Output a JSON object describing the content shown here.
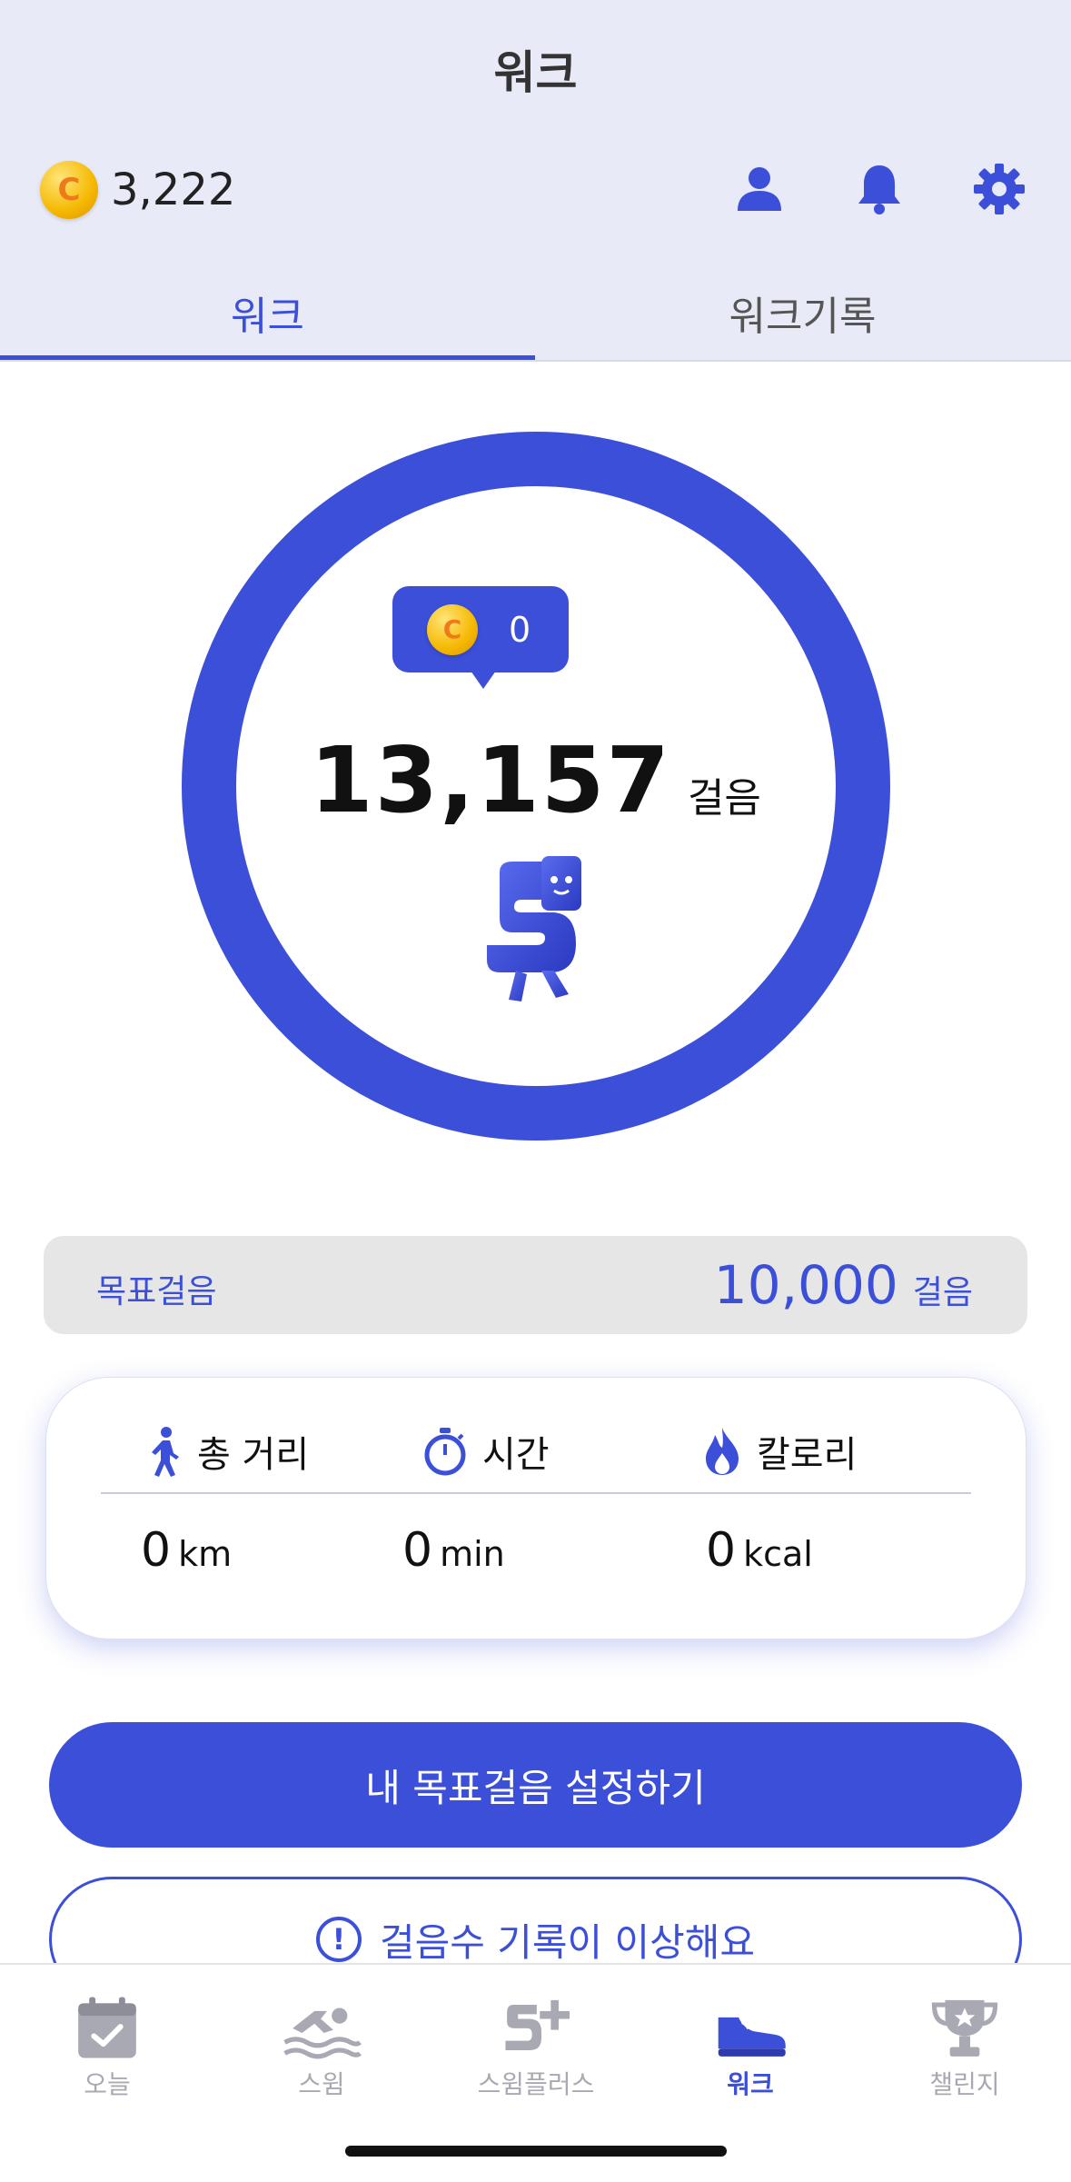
{
  "header": {
    "title": "워크",
    "coin_balance": "3,222",
    "icons": [
      "profile-icon",
      "bell-icon",
      "gear-icon"
    ]
  },
  "tabs": [
    {
      "label": "워크",
      "active": true
    },
    {
      "label": "워크기록",
      "active": false
    }
  ],
  "ring": {
    "earned_coins": "0",
    "steps": "13,157",
    "steps_unit": "걸음"
  },
  "goal": {
    "label": "목표걸음",
    "value": "10,000",
    "unit": "걸음"
  },
  "stats": {
    "distance": {
      "label": "총 거리",
      "value": "0",
      "unit": "km",
      "icon": "walk-icon"
    },
    "time": {
      "label": "시간",
      "value": "0",
      "unit": "min",
      "icon": "stopwatch-icon"
    },
    "calories": {
      "label": "칼로리",
      "value": "0",
      "unit": "kcal",
      "icon": "flame-icon"
    }
  },
  "buttons": {
    "set_goal": "내 목표걸음 설정하기",
    "report_issue": "걸음수 기록이 이상해요"
  },
  "bottom_nav": [
    {
      "label": "오늘",
      "icon": "calendar-check-icon",
      "active": false
    },
    {
      "label": "스윔",
      "icon": "swimmer-icon",
      "active": false
    },
    {
      "label": "스윔플러스",
      "icon": "s-plus-icon",
      "active": false
    },
    {
      "label": "워크",
      "icon": "shoe-icon",
      "active": true
    },
    {
      "label": "챌린지",
      "icon": "trophy-icon",
      "active": false
    }
  ],
  "colors": {
    "accent": "#3B4FD8",
    "header_bg": "#E8EAF7",
    "inactive": "#A9A9B3"
  }
}
